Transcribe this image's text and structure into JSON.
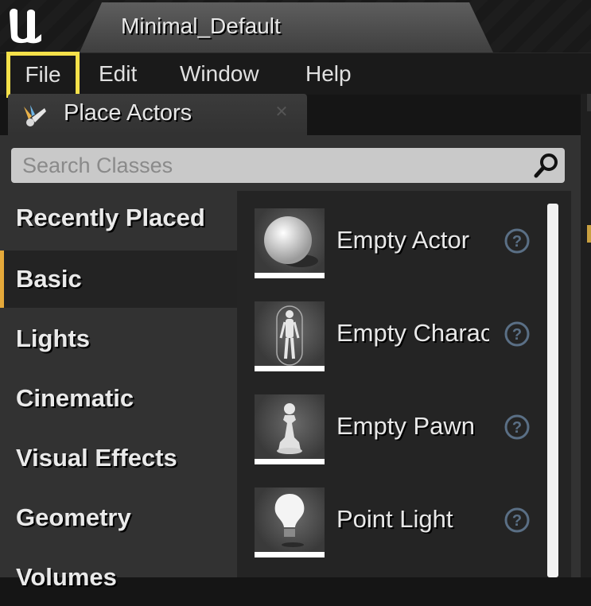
{
  "window": {
    "title": "Minimal_Default"
  },
  "menu": {
    "items": [
      "File",
      "Edit",
      "Window",
      "Help"
    ],
    "highlighted": "File"
  },
  "panel": {
    "tab_label": "Place Actors"
  },
  "search": {
    "placeholder": "Search Classes"
  },
  "categories": [
    {
      "label": "Recently Placed",
      "selected": false
    },
    {
      "label": "Basic",
      "selected": true
    },
    {
      "label": "Lights",
      "selected": false
    },
    {
      "label": "Cinematic",
      "selected": false
    },
    {
      "label": "Visual Effects",
      "selected": false
    },
    {
      "label": "Geometry",
      "selected": false
    },
    {
      "label": "Volumes",
      "selected": false
    }
  ],
  "actors": [
    {
      "label": "Empty Actor",
      "icon": "sphere-icon"
    },
    {
      "label": "Empty Character",
      "icon": "mannequin-icon"
    },
    {
      "label": "Empty Pawn",
      "icon": "pawn-icon"
    },
    {
      "label": "Point Light",
      "icon": "lightbulb-icon"
    }
  ],
  "colors": {
    "highlight": "#f5e14a",
    "selected_accent": "#e5a93a"
  }
}
